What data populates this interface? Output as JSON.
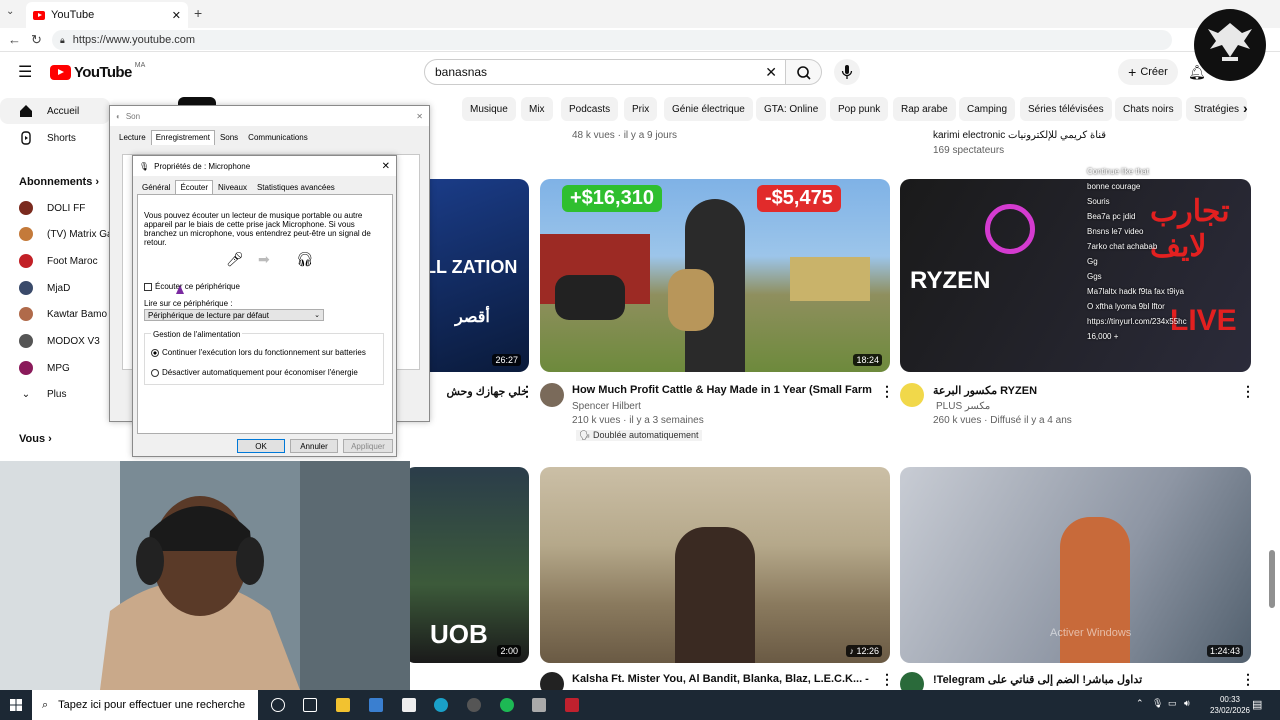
{
  "browser": {
    "tab_title": "YouTube",
    "url": "https://www.youtube.com"
  },
  "youtube": {
    "logo_text": "YouTube",
    "region": "MA",
    "search_value": "banasnas",
    "create_label": "Créer"
  },
  "sidebar": {
    "home": "Accueil",
    "shorts": "Shorts",
    "subscriptions": "Abonnements",
    "channels": [
      {
        "name": "DOLI FF",
        "color": "#7a2a1e"
      },
      {
        "name": "(TV) Matrix Ga",
        "color": "#c47a3a"
      },
      {
        "name": "Foot Maroc",
        "color": "#c22026"
      },
      {
        "name": "MjaD",
        "color": "#3a4a6a"
      },
      {
        "name": "Kawtar Bamo",
        "color": "#b06a4a"
      },
      {
        "name": "MODOX V3",
        "color": "#555555"
      },
      {
        "name": "MPG",
        "color": "#8a1a5a"
      }
    ],
    "more": "Plus",
    "you": "Vous"
  },
  "chips": [
    "rect",
    "Musique",
    "Mix",
    "Podcasts",
    "Prix",
    "Génie électrique",
    "GTA: Online",
    "Pop punk",
    "Rap arabe",
    "Camping",
    "Séries télévisées",
    "Chats noirs",
    "Stratégies"
  ],
  "top_row_meta": {
    "left_meta": "48 k vues · il y a 9 jours",
    "right_channel": "karimi electronic قناة كريمي للإلكترونيات",
    "right_meta": "169 spectateurs"
  },
  "videos_row1": [
    {
      "overlay": "LL ZATION",
      "overlay_ar": "أقصر",
      "duration": "26:27",
      "title": "خلي جهازك وحش"
    },
    {
      "badge_plus": "+$16,310",
      "badge_minus": "-$5,475",
      "duration": "18:24",
      "title": "How Much Profit Cattle & Hay Made in 1 Year (Small Farm)",
      "channel": "Spencer Hilbert",
      "meta": "210 k vues · il y a 3 semaines",
      "dub": "Doublée automatiquement"
    },
    {
      "overlay_ar": "تجارب لايف",
      "overlay": "RYZEN",
      "overlay_live": "LIVE",
      "title": "مكسور البرعة RYZEN",
      "channel": "PLUS مكسر",
      "meta": "260 k vues · Diffusé il y a 4 ans"
    }
  ],
  "videos_row2": [
    {
      "overlay": "UOB",
      "duration": "2:00"
    },
    {
      "duration": "12:26",
      "title": "Kalsha Ft. Mister You, Al Bandit, Blanka, Blaz, L.E.C.K... - Les"
    },
    {
      "duration": "1:24:43",
      "title": "!Telegram تداول مباشر! الضم إلى قناتي على",
      "watermark": "Activer Windows"
    }
  ],
  "chat": [
    "Continue like that",
    "bonne courage",
    "Souris",
    "Bea7a pc jdid",
    "Bnsns le7 video",
    "7arko chat achabab",
    "Gg",
    "Ggs",
    "Ma7laltx hadk f9ta fax t9iya",
    "O xftha lyoma 9bl lftor",
    "https://tinyurl.com/234x55hc",
    "16,000 +"
  ],
  "son_dialog": {
    "title": "Son",
    "tabs": [
      "Lecture",
      "Enregistrement",
      "Sons",
      "Communications"
    ]
  },
  "mic_dialog": {
    "title": "Propriétés de : Microphone",
    "tabs": [
      "Général",
      "Écouter",
      "Niveaux",
      "Statistiques avancées"
    ],
    "description": "Vous pouvez écouter un lecteur de musique portable ou autre appareil par le biais de cette prise jack Microphone. Si vous branchez un microphone, vous entendrez peut-être un signal de retour.",
    "listen_checkbox": "Écouter ce périphérique",
    "playback_label": "Lire sur ce périphérique :",
    "playback_value": "Périphérique de lecture par défaut",
    "power_group": "Gestion de l'alimentation",
    "radio1": "Continuer l'exécution lors du fonctionnement sur batteries",
    "radio2": "Désactiver automatiquement pour économiser l'énergie",
    "ok": "OK",
    "cancel": "Annuler",
    "apply": "Appliquer"
  },
  "taskbar": {
    "search_placeholder": "Tapez ici pour effectuer une recherche",
    "time": "00:33",
    "date": "23/02/2026"
  },
  "colors": {
    "youtube_red": "#ff0000",
    "taskbar": "#1c2834"
  }
}
